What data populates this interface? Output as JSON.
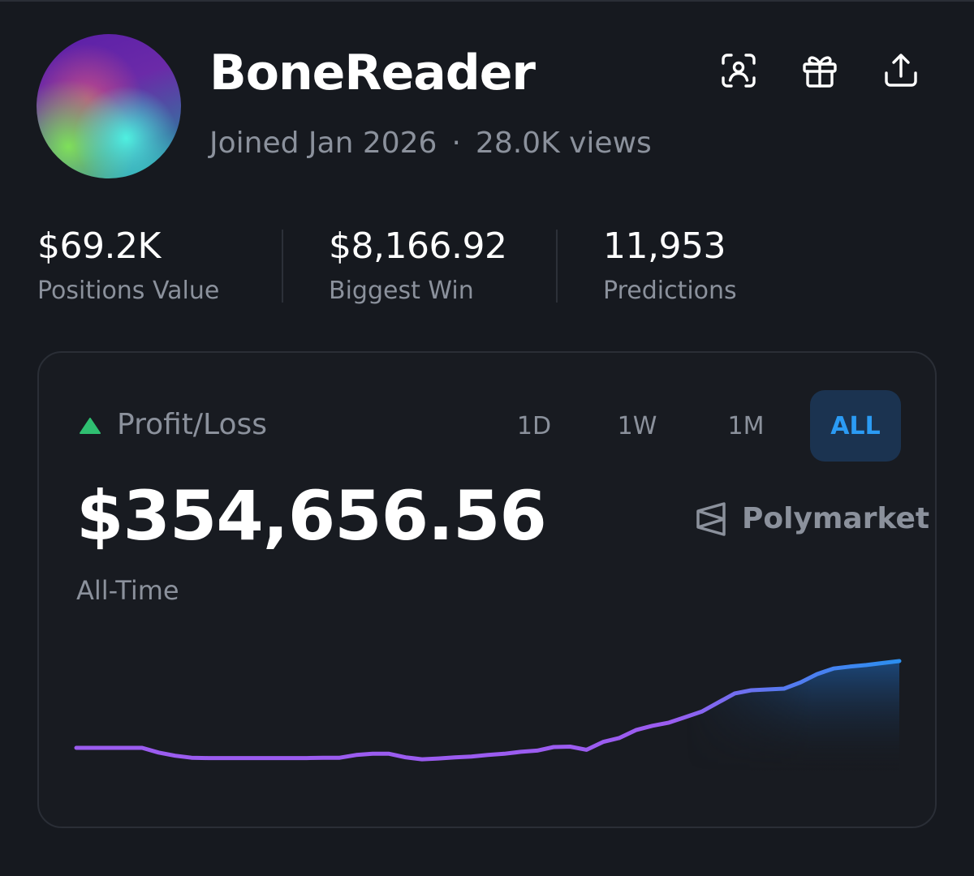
{
  "profile": {
    "name": "BoneReader",
    "joined": "Joined Jan 2026",
    "separator": "·",
    "views": "28.0K views",
    "avatar_colors": [
      "#5a1fa8",
      "#c04a8a",
      "#7fe05a",
      "#4ff0e0"
    ]
  },
  "header_icons": [
    "scan-face-icon",
    "gift-icon",
    "share-upload-icon"
  ],
  "stats": [
    {
      "value": "$69.2K",
      "label": "Positions Value"
    },
    {
      "value": "$8,166.92",
      "label": "Biggest Win"
    },
    {
      "value": "11,953",
      "label": "Predictions"
    }
  ],
  "card": {
    "title": "Profit/Loss",
    "indicator": "up",
    "ranges": [
      "1D",
      "1W",
      "1M",
      "ALL"
    ],
    "active_range": "ALL",
    "amount": "$354,656.56",
    "period": "All-Time",
    "source": "Polymarket"
  },
  "colors": {
    "background": "#16191f",
    "card": "#181b21",
    "muted_text": "#8b919c",
    "accent_blue": "#2b9bf4",
    "active_bg": "#1b3350",
    "up_green": "#2fbf71",
    "line_start": "#9b5cf0",
    "line_end": "#2b8ff0"
  },
  "chart_data": {
    "type": "line",
    "x": [
      0,
      2,
      4,
      6,
      8,
      10,
      12,
      14,
      16,
      18,
      20,
      22,
      24,
      26,
      28,
      30,
      32,
      34,
      36,
      38,
      40,
      42,
      44,
      46,
      48,
      50,
      52,
      54,
      56,
      58,
      60,
      62,
      64,
      66,
      68,
      70,
      72,
      74,
      76,
      78,
      80,
      82,
      84,
      86,
      88,
      90,
      92,
      94,
      96,
      98,
      100
    ],
    "values": [
      0,
      0,
      0,
      0,
      0,
      -1.2,
      -2.0,
      -2.5,
      -2.6,
      -2.6,
      -2.6,
      -2.6,
      -2.6,
      -2.6,
      -2.6,
      -2.5,
      -2.5,
      -1.8,
      -1.5,
      -1.5,
      -2.4,
      -2.9,
      -2.7,
      -2.4,
      -2.2,
      -1.8,
      -1.5,
      -1.0,
      -0.7,
      0.2,
      0.3,
      -0.5,
      1.5,
      2.5,
      4.5,
      5.6,
      6.4,
      7.8,
      9.2,
      11.5,
      13.8,
      14.6,
      14.8,
      15.0,
      16.6,
      18.7,
      20.1,
      20.6,
      21.0,
      21.5,
      22.0
    ],
    "note_units": "relative profit, unlabeled axes",
    "xlabel": "",
    "ylabel": "",
    "grid": false,
    "area_fill": true
  }
}
